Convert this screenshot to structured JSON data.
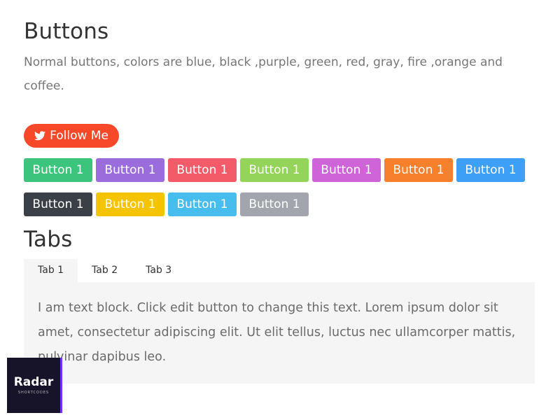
{
  "buttons_section": {
    "title": "Buttons",
    "description": "Normal buttons, colors are blue, black ,purple, green, red, gray, fire ,orange and coffee.",
    "follow_button": {
      "label": "Follow Me",
      "icon": "twitter-icon",
      "color": "#f8482a"
    },
    "row1": [
      {
        "label": "Button 1",
        "color": "#3cc47c"
      },
      {
        "label": "Button 1",
        "color": "#9b6cdb"
      },
      {
        "label": "Button 1",
        "color": "#f45b69"
      },
      {
        "label": "Button 1",
        "color": "#95d45a"
      },
      {
        "label": "Button 1",
        "color": "#cf64d9"
      },
      {
        "label": "Button 1",
        "color": "#f7802c"
      },
      {
        "label": "Button 1",
        "color": "#3d9ff5"
      }
    ],
    "row2": [
      {
        "label": "Button 1",
        "color": "#3b3f48"
      },
      {
        "label": "Button 1",
        "color": "#f5c400"
      },
      {
        "label": "Button 1",
        "color": "#46bdec"
      },
      {
        "label": "Button 1",
        "color": "#a2a5ad"
      }
    ]
  },
  "tabs_section": {
    "title": "Tabs",
    "tabs": [
      {
        "label": "Tab 1",
        "active": true
      },
      {
        "label": "Tab 2",
        "active": false
      },
      {
        "label": "Tab 3",
        "active": false
      }
    ],
    "panel_text": "I am text block. Click edit button to change this text. Lorem ipsum dolor sit amet, consectetur adipiscing elit. Ut elit tellus, luctus nec ullamcorper mattis, pulvinar dapibus leo."
  },
  "logo": {
    "name": "Radar",
    "subtitle": "SHORTCODES",
    "accent": "#7a2dff",
    "background": "#171329"
  }
}
